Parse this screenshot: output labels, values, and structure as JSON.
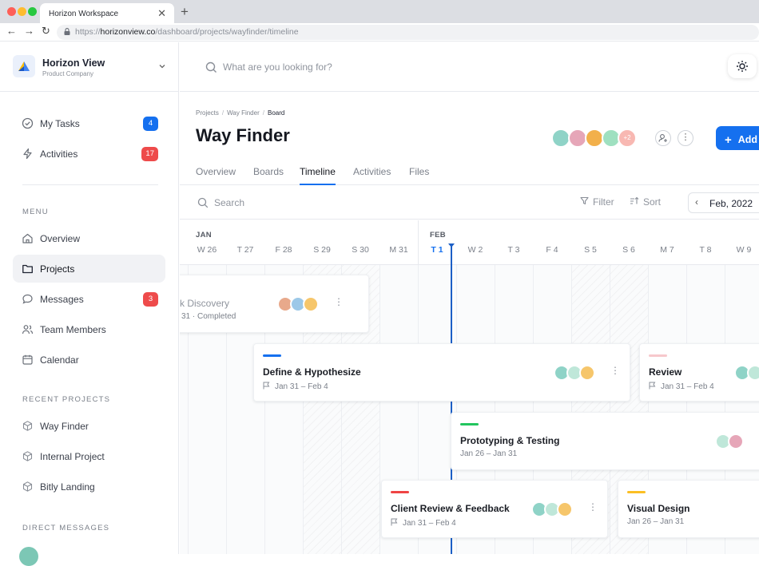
{
  "browser": {
    "tab_title": "Horizon Workspace",
    "tab_close": "✕",
    "new_tab": "+",
    "url_scheme": "https://",
    "url_host": "horizonview.co",
    "url_path": "/dashboard/projects/wayfinder/timeline"
  },
  "workspace": {
    "name": "Horizon View",
    "subtitle": "Product Company"
  },
  "sidebar": {
    "top_items": [
      {
        "label": "My Tasks",
        "badge": "4"
      },
      {
        "label": "Activities",
        "badge": "17"
      }
    ],
    "menu_heading": "MENU",
    "menu_items": [
      {
        "label": "Overview"
      },
      {
        "label": "Projects"
      },
      {
        "label": "Messages",
        "badge": "3"
      },
      {
        "label": "Team Members"
      },
      {
        "label": "Calendar"
      }
    ],
    "recent_heading": "RECENT PROJECTS",
    "recent_items": [
      {
        "label": "Way Finder"
      },
      {
        "label": "Internal Project"
      },
      {
        "label": "Bitly Landing"
      }
    ],
    "dm_heading": "DIRECT MESSAGES"
  },
  "topbar": {
    "search_placeholder": "What are you looking for?"
  },
  "project": {
    "breadcrumb": [
      "Projects",
      "Way Finder",
      "Board"
    ],
    "title": "Way Finder",
    "members_more": "+2",
    "add_label": "Add"
  },
  "tabs": [
    "Overview",
    "Boards",
    "Timeline",
    "Activities",
    "Files"
  ],
  "toolbar": {
    "search_label": "Search",
    "filter_label": "Filter",
    "sort_label": "Sort",
    "date": "Feb, 2022",
    "prev": "‹"
  },
  "timeline": {
    "months": [
      "JAN",
      "FEB"
    ],
    "days": [
      "W 26",
      "T 27",
      "F 28",
      "S 29",
      "S 30",
      "M 31",
      "T 1",
      "W 2",
      "T 3",
      "F 4",
      "S 5",
      "S 6",
      "M 7",
      "T 8",
      "W 9"
    ],
    "today": "T 1",
    "tasks": [
      {
        "title": "Discovery",
        "title_prefix": "k ",
        "meta": "31 · Completed",
        "color": "#c9ccd2"
      },
      {
        "title": "Define & Hypothesize",
        "meta": "Jan 31 – Feb 4",
        "color": "#1570ef"
      },
      {
        "title": "Review",
        "meta": "Jan 31 – Feb 4",
        "color": "#f7c8cc"
      },
      {
        "title": "Prototyping & Testing",
        "meta": "Jan 26 – Jan 31",
        "color": "#22c55e"
      },
      {
        "title": "Client Review & Feedback",
        "meta": "Jan 31 – Feb 4",
        "color": "#ef4444"
      },
      {
        "title": "Visual Design",
        "meta": "Jan 26 – Jan 31",
        "color": "#fbbf24"
      }
    ]
  },
  "colors": {
    "accent": "#1570ef",
    "badge_red": "#ee4b4b",
    "today_line": "#1c5fc6"
  }
}
